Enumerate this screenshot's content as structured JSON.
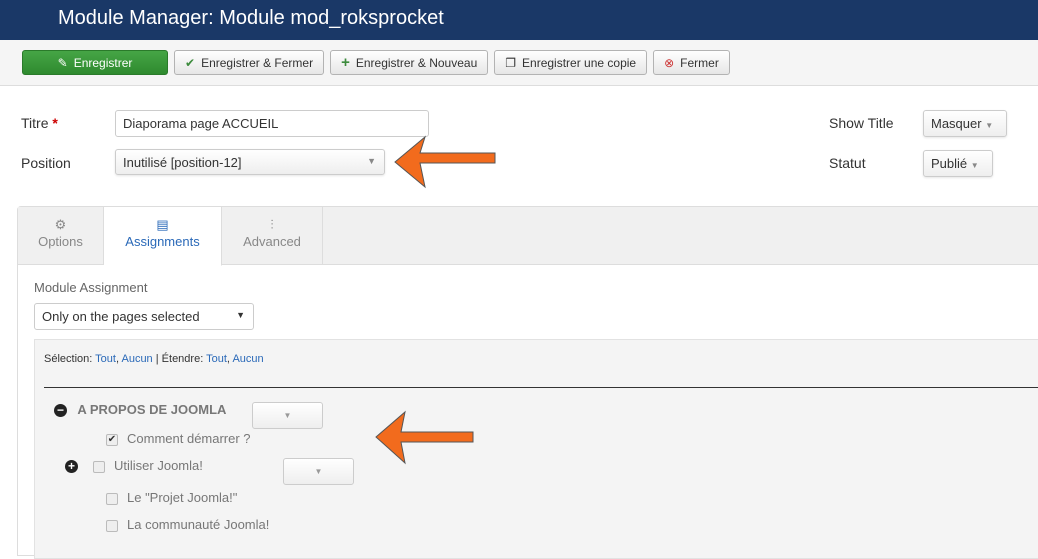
{
  "header": {
    "title": "Module Manager: Module mod_roksprocket"
  },
  "toolbar": {
    "save": "Enregistrer",
    "save_close": "Enregistrer & Fermer",
    "save_new": "Enregistrer & Nouveau",
    "save_copy": "Enregistrer une copie",
    "close": "Fermer"
  },
  "form": {
    "title_label": "Titre",
    "required": "*",
    "title_value": "Diaporama page ACCUEIL",
    "position_label": "Position",
    "position_value": "Inutilisé [position-12]",
    "show_title_label": "Show Title",
    "show_title_value": "Masquer",
    "status_label": "Statut",
    "status_value": "Publié"
  },
  "tabs": [
    {
      "label": "Options"
    },
    {
      "label": "Assignments"
    },
    {
      "label": "Advanced"
    }
  ],
  "assignment": {
    "label": "Module Assignment",
    "value": "Only on the pages selected"
  },
  "selection": {
    "select_label": "Sélection:",
    "all": "Tout",
    "none": "Aucun",
    "sep": "|",
    "expand_label": "Étendre:"
  },
  "tree": {
    "menu": "A PROPOS DE JOOMLA",
    "items": [
      {
        "label": "Comment démarrer ?",
        "checked": true
      },
      {
        "label": "Utiliser Joomla!",
        "checked": false
      },
      {
        "label": "Le \"Projet Joomla!\"",
        "checked": false
      },
      {
        "label": "La communauté Joomla!",
        "checked": false
      }
    ]
  },
  "colors": {
    "header": "#1a3867",
    "primary": "#3d9b3d",
    "arrow": "#f26b1d",
    "link": "#2a69b8"
  }
}
